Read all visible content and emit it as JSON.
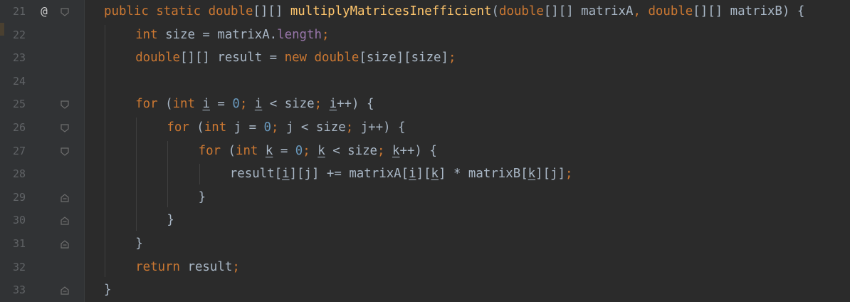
{
  "editor": {
    "colors": {
      "background": "#2b2b2b",
      "gutter": "#313335",
      "line_number": "#606366",
      "keyword": "#cc7832",
      "function": "#ffc66d",
      "number": "#6897bb",
      "field": "#9876aa",
      "identifier": "#a9b7c6"
    },
    "lines": [
      {
        "number": "21",
        "marker": "@",
        "fold": "fold-start",
        "indent": 0,
        "tokens": [
          {
            "t": "public",
            "c": "kw"
          },
          {
            "t": " "
          },
          {
            "t": "static",
            "c": "kw"
          },
          {
            "t": " "
          },
          {
            "t": "double",
            "c": "kw"
          },
          {
            "t": "[][] "
          },
          {
            "t": "multiplyMatricesInefficient",
            "c": "fn"
          },
          {
            "t": "("
          },
          {
            "t": "double",
            "c": "kw"
          },
          {
            "t": "[][] matrixA"
          },
          {
            "t": ",",
            "c": "semi"
          },
          {
            "t": " "
          },
          {
            "t": "double",
            "c": "kw"
          },
          {
            "t": "[][] matrixB) {"
          }
        ]
      },
      {
        "number": "22",
        "marker": "",
        "fold": "",
        "indent": 1,
        "tokens": [
          {
            "t": "int",
            "c": "kw"
          },
          {
            "t": " size = matrixA."
          },
          {
            "t": "length",
            "c": "fld"
          },
          {
            "t": ";",
            "c": "semi"
          }
        ]
      },
      {
        "number": "23",
        "marker": "",
        "fold": "",
        "indent": 1,
        "tokens": [
          {
            "t": "double",
            "c": "kw"
          },
          {
            "t": "[][] result = "
          },
          {
            "t": "new",
            "c": "kw"
          },
          {
            "t": " "
          },
          {
            "t": "double",
            "c": "kw"
          },
          {
            "t": "[size][size]"
          },
          {
            "t": ";",
            "c": "semi"
          }
        ]
      },
      {
        "number": "24",
        "marker": "",
        "fold": "",
        "indent": 1,
        "tokens": []
      },
      {
        "number": "25",
        "marker": "",
        "fold": "fold-start",
        "indent": 1,
        "tokens": [
          {
            "t": "for",
            "c": "kw"
          },
          {
            "t": " ("
          },
          {
            "t": "int",
            "c": "kw"
          },
          {
            "t": " "
          },
          {
            "t": "i",
            "u": true
          },
          {
            "t": " = "
          },
          {
            "t": "0",
            "c": "num"
          },
          {
            "t": ";",
            "c": "semi"
          },
          {
            "t": " "
          },
          {
            "t": "i",
            "u": true
          },
          {
            "t": " < size"
          },
          {
            "t": ";",
            "c": "semi"
          },
          {
            "t": " "
          },
          {
            "t": "i",
            "u": true
          },
          {
            "t": "++) {"
          }
        ]
      },
      {
        "number": "26",
        "marker": "",
        "fold": "fold-start",
        "indent": 2,
        "tokens": [
          {
            "t": "for",
            "c": "kw"
          },
          {
            "t": " ("
          },
          {
            "t": "int",
            "c": "kw"
          },
          {
            "t": " j = "
          },
          {
            "t": "0",
            "c": "num"
          },
          {
            "t": ";",
            "c": "semi"
          },
          {
            "t": " j < size"
          },
          {
            "t": ";",
            "c": "semi"
          },
          {
            "t": " j++) {"
          }
        ]
      },
      {
        "number": "27",
        "marker": "",
        "fold": "fold-start",
        "indent": 3,
        "tokens": [
          {
            "t": "for",
            "c": "kw"
          },
          {
            "t": " ("
          },
          {
            "t": "int",
            "c": "kw"
          },
          {
            "t": " "
          },
          {
            "t": "k",
            "u": true
          },
          {
            "t": " = "
          },
          {
            "t": "0",
            "c": "num"
          },
          {
            "t": ";",
            "c": "semi"
          },
          {
            "t": " "
          },
          {
            "t": "k",
            "u": true
          },
          {
            "t": " < size"
          },
          {
            "t": ";",
            "c": "semi"
          },
          {
            "t": " "
          },
          {
            "t": "k",
            "u": true
          },
          {
            "t": "++) {"
          }
        ]
      },
      {
        "number": "28",
        "marker": "",
        "fold": "",
        "indent": 4,
        "tokens": [
          {
            "t": "result["
          },
          {
            "t": "i",
            "u": true
          },
          {
            "t": "][j] += matrixA["
          },
          {
            "t": "i",
            "u": true
          },
          {
            "t": "]["
          },
          {
            "t": "k",
            "u": true
          },
          {
            "t": "] * matrixB["
          },
          {
            "t": "k",
            "u": true
          },
          {
            "t": "][j]"
          },
          {
            "t": ";",
            "c": "semi"
          }
        ]
      },
      {
        "number": "29",
        "marker": "",
        "fold": "fold-end",
        "indent": 3,
        "tokens": [
          {
            "t": "}"
          }
        ]
      },
      {
        "number": "30",
        "marker": "",
        "fold": "fold-end",
        "indent": 2,
        "tokens": [
          {
            "t": "}"
          }
        ]
      },
      {
        "number": "31",
        "marker": "",
        "fold": "fold-end",
        "indent": 1,
        "tokens": [
          {
            "t": "}"
          }
        ]
      },
      {
        "number": "32",
        "marker": "",
        "fold": "",
        "indent": 1,
        "tokens": [
          {
            "t": "return",
            "c": "kw"
          },
          {
            "t": " result"
          },
          {
            "t": ";",
            "c": "semi"
          }
        ]
      },
      {
        "number": "33",
        "marker": "",
        "fold": "fold-end",
        "indent": 0,
        "tokens": [
          {
            "t": "}"
          }
        ]
      }
    ]
  }
}
